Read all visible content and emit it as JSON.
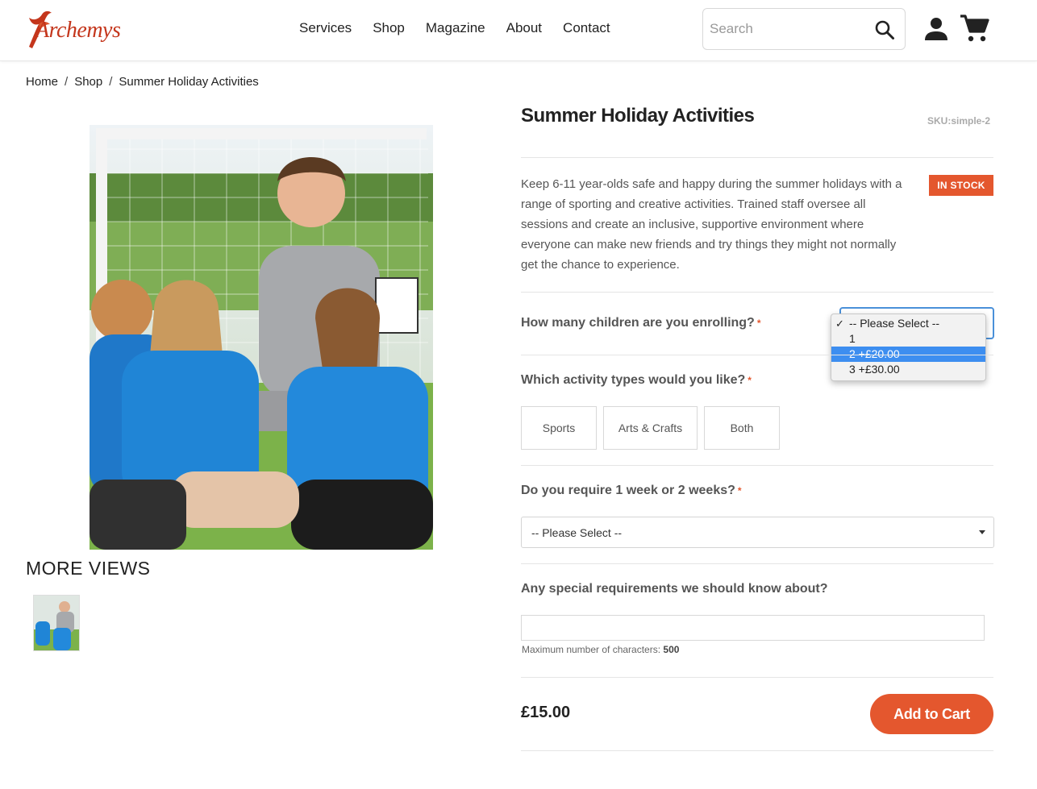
{
  "header": {
    "logo_text": "Archemys",
    "nav": [
      "Services",
      "Shop",
      "Magazine",
      "About",
      "Contact"
    ],
    "search_placeholder": "Search"
  },
  "breadcrumb": [
    "Home",
    "Shop",
    "Summer Holiday Activities"
  ],
  "gallery": {
    "more_views_label": "MORE VIEWS"
  },
  "product": {
    "title": "Summer Holiday Activities",
    "sku": "SKU:simple-2",
    "stock": "IN STOCK",
    "description": "Keep 6-11 year-olds safe and happy during the summer holidays with a range of sporting and creative activities. Trained staff oversee all sessions and create an inclusive, supportive environment where everyone can make new friends and try things they might not normally get the chance to experience.",
    "price": "£15.00",
    "add_to_cart": "Add to Cart"
  },
  "options": {
    "children_label": "How many children are you enrolling?",
    "children_options": [
      "-- Please Select --",
      "1",
      "2 +£20.00",
      "3 +£30.00"
    ],
    "children_highlighted": "2 +£20.00",
    "activity_label": "Which activity types would you like?",
    "activity_options": [
      "Sports",
      "Arts & Crafts",
      "Both"
    ],
    "weeks_label": "Do you require 1 week or 2 weeks?",
    "weeks_value": "-- Please Select --",
    "special_label": "Any special requirements we should know about?",
    "max_chars_label": "Maximum number of characters:",
    "max_chars_value": "500",
    "required_mark": "*"
  },
  "colors": {
    "accent": "#e4572e",
    "highlight": "#3d8ef0",
    "brand": "#c4361c"
  }
}
